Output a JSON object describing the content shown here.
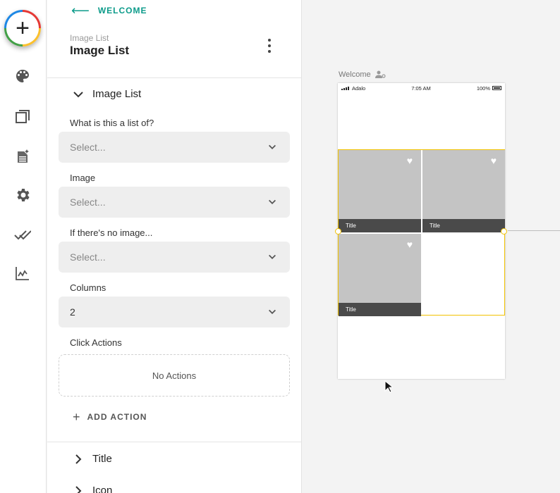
{
  "rail": {
    "add_symbol": "+",
    "icons": [
      "palette-icon",
      "screens-icon",
      "database-icon",
      "settings-icon",
      "publish-icon",
      "analytics-icon"
    ]
  },
  "panel": {
    "back_label": "WELCOME",
    "component_subtitle": "Image List",
    "component_title": "Image List",
    "section_title": "Image List",
    "fields": [
      {
        "label": "What is this a list of?",
        "value": "Select..."
      },
      {
        "label": "Image",
        "value": "Select..."
      },
      {
        "label": "If there's no image...",
        "value": "Select..."
      },
      {
        "label": "Columns",
        "value": "2"
      }
    ],
    "click_actions_label": "Click Actions",
    "no_actions_text": "No Actions",
    "add_action_label": "ADD ACTION",
    "next_section_title": "Title",
    "partial_section_title": "Icon"
  },
  "canvas": {
    "screen_name": "Welcome",
    "status_bar": {
      "carrier": "Adalo",
      "time": "7:05 AM",
      "battery": "100%"
    },
    "tiles": [
      {
        "caption": "Title"
      },
      {
        "caption": "Title"
      },
      {
        "caption": "Title"
      }
    ]
  },
  "colors": {
    "accent": "#0c9b8a",
    "selection": "#f2c200",
    "tile": "#c4c4c4",
    "caption_bar": "#4a4a4a"
  }
}
